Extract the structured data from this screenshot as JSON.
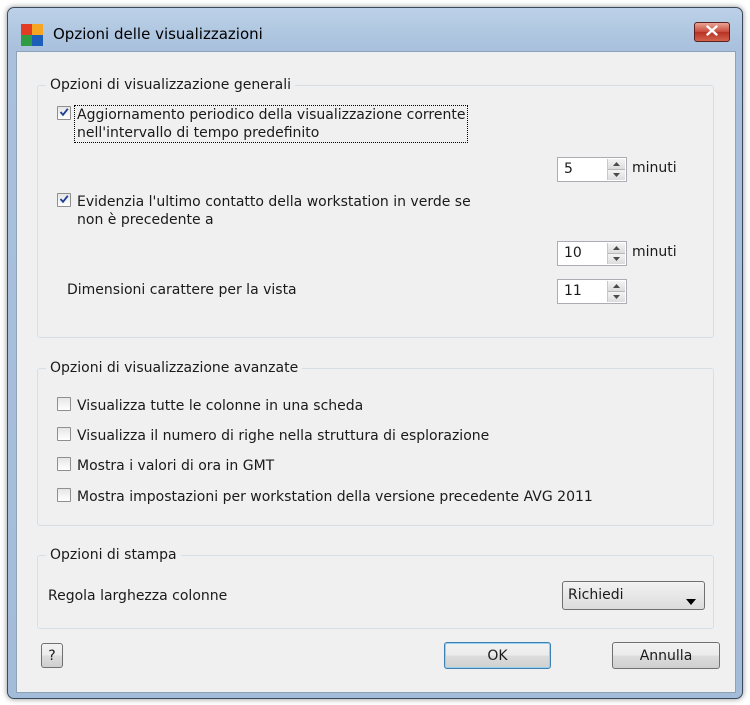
{
  "window": {
    "title": "Opzioni delle visualizzazioni"
  },
  "general": {
    "legend": "Opzioni di visualizzazione generali",
    "periodic_update": {
      "checked": true,
      "line1": "Aggiornamento periodico della visualizzazione corrente",
      "line2": "nell'intervallo di tempo predefinito",
      "value": "5",
      "unit": "minuti"
    },
    "highlight_contact": {
      "checked": true,
      "line1": "Evidenzia l'ultimo contatto della workstation in verde se",
      "line2": "non è precedente a",
      "value": "10",
      "unit": "minuti"
    },
    "font_size": {
      "label": "Dimensioni carattere per la vista",
      "value": "11"
    }
  },
  "advanced": {
    "legend": "Opzioni di visualizzazione avanzate",
    "options": [
      {
        "label": "Visualizza tutte le colonne in una scheda",
        "checked": false
      },
      {
        "label": "Visualizza il numero di righe nella struttura di esplorazione",
        "checked": false
      },
      {
        "label": "Mostra i valori di ora in GMT",
        "checked": false
      },
      {
        "label": "Mostra impostazioni per workstation della versione precedente AVG 2011",
        "checked": false
      }
    ]
  },
  "print": {
    "legend": "Opzioni di stampa",
    "column_width_label": "Regola larghezza colonne",
    "column_width_value": "Richiedi"
  },
  "buttons": {
    "help": "?",
    "ok": "OK",
    "cancel": "Annulla"
  },
  "icons": {
    "app": "avg-logo-icon",
    "close": "close-icon",
    "check": "checkmark-icon",
    "spin_up": "spin-up-icon",
    "spin_down": "spin-down-icon",
    "dropdown": "chevron-down-icon"
  },
  "colors": {
    "accent_check": "#1c3f94",
    "title_bar": "#a9c1dd",
    "dialog_bg": "#f0f0f0"
  }
}
